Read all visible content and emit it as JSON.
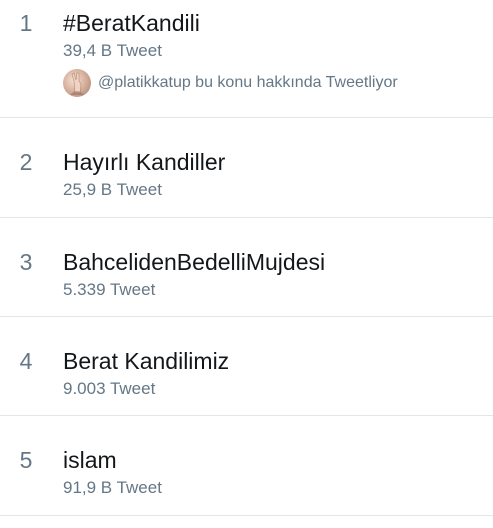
{
  "trends": [
    {
      "rank": "1",
      "name": "#BeratKandili",
      "count": "39,4 B Tweet",
      "context": "@platikkatup bu konu hakkında Tweetliyor"
    },
    {
      "rank": "2",
      "name": "Hayırlı Kandiller",
      "count": "25,9 B Tweet"
    },
    {
      "rank": "3",
      "name": "BahcelidenBedelliMujdesi",
      "count": "5.339 Tweet"
    },
    {
      "rank": "4",
      "name": "Berat Kandilimiz",
      "count": "9.003 Tweet"
    },
    {
      "rank": "5",
      "name": "islam",
      "count": "91,9 B Tweet"
    }
  ],
  "colors": {
    "primary_text": "#14171a",
    "secondary_text": "#657786",
    "divider": "#e1e8ed",
    "background": "#ffffff"
  }
}
